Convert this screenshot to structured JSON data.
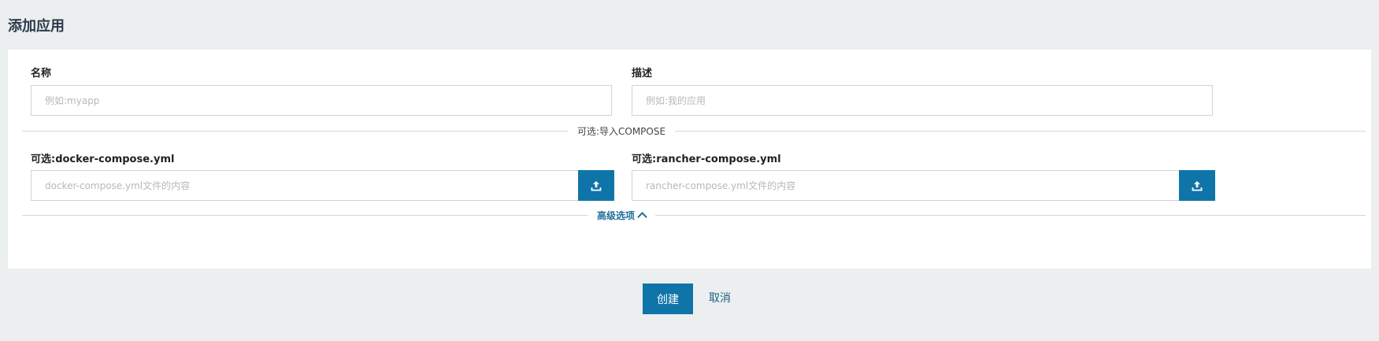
{
  "page": {
    "title": "添加应用"
  },
  "form": {
    "name": {
      "label": "名称",
      "placeholder": "例如:myapp",
      "value": ""
    },
    "description": {
      "label": "描述",
      "placeholder": "例如:我的应用",
      "value": ""
    },
    "compose_divider": "可选:导入COMPOSE",
    "docker_compose": {
      "label": "可选:docker-compose.yml",
      "placeholder": "docker-compose.yml文件的内容",
      "value": ""
    },
    "rancher_compose": {
      "label": "可选:rancher-compose.yml",
      "placeholder": "rancher-compose.yml文件的内容",
      "value": ""
    },
    "advanced_toggle": "高级选项"
  },
  "actions": {
    "create_label": "创建",
    "cancel_label": "取消"
  },
  "icons": {
    "upload": "upload-icon",
    "chevron": "chevron-up-icon"
  },
  "colors": {
    "primary": "#0f75a8",
    "link": "#1f6f9a",
    "background": "#ebeff0"
  }
}
